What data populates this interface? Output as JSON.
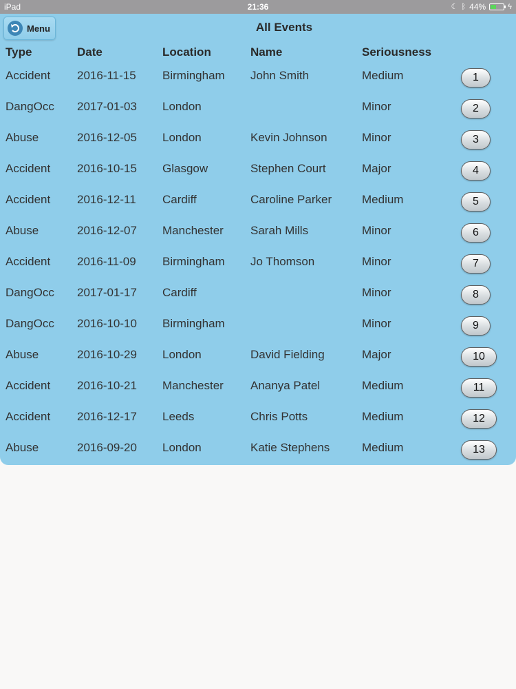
{
  "statusbar": {
    "device": "iPad",
    "time": "21:36",
    "battery": "44%",
    "battery_level": 0.44,
    "icons": [
      "moon-icon",
      "bluetooth-icon",
      "battery-icon",
      "charging-icon"
    ]
  },
  "header": {
    "menu_label": "Menu",
    "title": "All Events"
  },
  "table": {
    "columns": [
      "Type",
      "Date",
      "Location",
      "Name",
      "Seriousness"
    ],
    "rows": [
      {
        "type": "Accident",
        "date": "2016-11-15",
        "location": "Birmingham",
        "name": "John Smith",
        "seriousness": "Medium",
        "num": "1"
      },
      {
        "type": "DangOcc",
        "date": "2017-01-03",
        "location": "London",
        "name": "",
        "seriousness": "Minor",
        "num": "2"
      },
      {
        "type": "Abuse",
        "date": "2016-12-05",
        "location": "London",
        "name": "Kevin Johnson",
        "seriousness": "Minor",
        "num": "3"
      },
      {
        "type": "Accident",
        "date": "2016-10-15",
        "location": "Glasgow",
        "name": "Stephen Court",
        "seriousness": "Major",
        "num": "4"
      },
      {
        "type": "Accident",
        "date": "2016-12-11",
        "location": "Cardiff",
        "name": "Caroline Parker",
        "seriousness": "Medium",
        "num": "5"
      },
      {
        "type": "Abuse",
        "date": "2016-12-07",
        "location": "Manchester",
        "name": "Sarah Mills",
        "seriousness": "Minor",
        "num": "6"
      },
      {
        "type": "Accident",
        "date": "2016-11-09",
        "location": "Birmingham",
        "name": "Jo Thomson",
        "seriousness": "Minor",
        "num": "7"
      },
      {
        "type": "DangOcc",
        "date": "2017-01-17",
        "location": "Cardiff",
        "name": "",
        "seriousness": "Minor",
        "num": "8"
      },
      {
        "type": "DangOcc",
        "date": "2016-10-10",
        "location": "Birmingham",
        "name": "",
        "seriousness": "Minor",
        "num": "9"
      },
      {
        "type": "Abuse",
        "date": "2016-10-29",
        "location": "London",
        "name": "David Fielding",
        "seriousness": "Major",
        "num": "10"
      },
      {
        "type": "Accident",
        "date": "2016-10-21",
        "location": "Manchester",
        "name": "Ananya Patel",
        "seriousness": "Medium",
        "num": "11"
      },
      {
        "type": "Accident",
        "date": "2016-12-17",
        "location": "Leeds",
        "name": "Chris Potts",
        "seriousness": "Medium",
        "num": "12"
      },
      {
        "type": "Abuse",
        "date": "2016-09-20",
        "location": "London",
        "name": "Katie Stephens",
        "seriousness": "Medium",
        "num": "13"
      }
    ]
  },
  "colors": {
    "panel": "#8fcdea",
    "statusbar": "#9c9b9d",
    "page_background": "#f9f8f7"
  }
}
